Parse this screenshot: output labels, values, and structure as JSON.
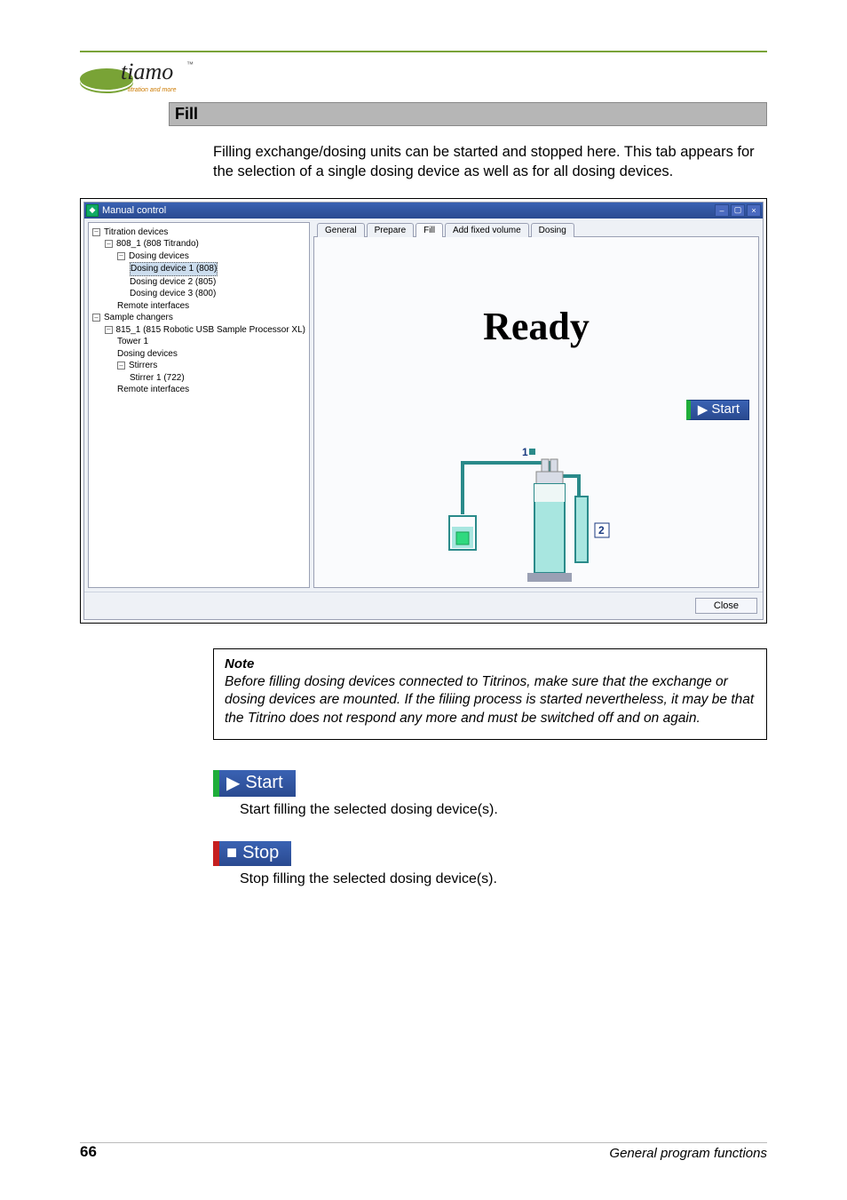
{
  "sectionTitle": "Fill",
  "intro": "Filling exchange/dosing units can be started and stopped here. This tab appears for the selection of a single dosing device as well as for all dosing devices.",
  "window": {
    "title": "Manual control",
    "tree": {
      "root1": "Titration devices",
      "l1a": "808_1 (808 Titrando)",
      "l2a": "Dosing devices",
      "dd1": "Dosing device 1 (808)",
      "dd2": "Dosing device 2 (805)",
      "dd3": "Dosing device 3 (800)",
      "ri1": "Remote interfaces",
      "root2": "Sample changers",
      "l1b": "815_1 (815 Robotic USB Sample Processor XL)",
      "tower": "Tower 1",
      "dd": "Dosing devices",
      "stir": "Stirrers",
      "stir1": "Stirrer 1 (722)",
      "ri2": "Remote interfaces"
    },
    "tabs": {
      "general": "General",
      "prepare": "Prepare",
      "fill": "Fill",
      "addfixed": "Add fixed volume",
      "dosing": "Dosing"
    },
    "readyText": "Ready",
    "startLabel": "Start",
    "diagram": {
      "port1": "1",
      "port2": "2"
    },
    "closeLabel": "Close"
  },
  "note": {
    "title": "Note",
    "body": "Before filling dosing devices connected to Titrinos, make sure that the exchange or dosing devices are mounted. If the filiing process is started nevertheless, it may be that the Titrino does not respond any more and must be switched off and on again."
  },
  "startBtn": {
    "label": "Start",
    "desc": "Start filling the selected dosing device(s)."
  },
  "stopBtn": {
    "label": "Stop",
    "desc": "Stop filling the selected dosing device(s)."
  },
  "logoText": "tiamo",
  "logoTag": "titration and more",
  "pageNumber": "66",
  "pageSection": "General program functions"
}
